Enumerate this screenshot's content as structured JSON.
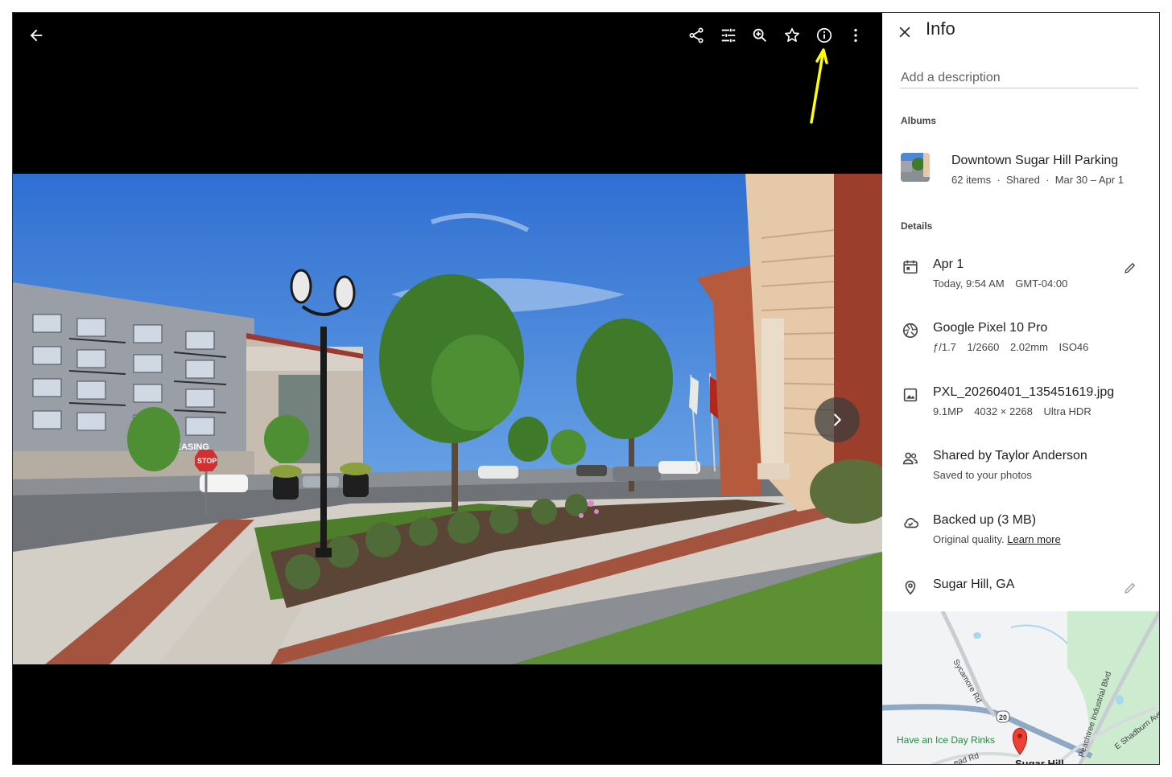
{
  "toolbar": {
    "back_icon": "arrow-back-icon",
    "share_icon": "share-icon",
    "edit_icon": "tune-icon",
    "zoom_icon": "zoom-in-icon",
    "favorite_icon": "star-icon",
    "info_icon": "info-icon",
    "more_icon": "more-vert-icon"
  },
  "viewer": {
    "next_icon": "chevron-right-icon",
    "annotation_arrow_color": "#ffff00"
  },
  "photo": {
    "sign_leasing": "LEASING",
    "sign_stop": "STOP"
  },
  "panel": {
    "title": "Info",
    "description_placeholder": "Add a description",
    "albums_label": "Albums",
    "details_label": "Details"
  },
  "album": {
    "name": "Downtown Sugar Hill Parking",
    "items": "62 items",
    "sep": "·",
    "shared": "Shared",
    "dates": "Mar 30 – Apr 1"
  },
  "details": {
    "date": {
      "main": "Apr 1",
      "time": "Today, 9:54 AM",
      "tz": "GMT-04:00"
    },
    "camera": {
      "main": "Google Pixel 10 Pro",
      "aperture": "ƒ/1.7",
      "shutter": "1/2660",
      "focal": "2.02mm",
      "iso": "ISO46"
    },
    "file": {
      "main": "PXL_20260401_135451619.jpg",
      "mp": "9.1MP",
      "dims": "4032 × 2268",
      "hdr": "Ultra HDR"
    },
    "shared": {
      "main": "Shared by Taylor Anderson",
      "sub": "Saved to your photos"
    },
    "backup": {
      "main": "Backed up (3 MB)",
      "sub": "Original quality.",
      "link": "Learn more"
    },
    "location": {
      "main": "Sugar Hill, GA"
    }
  },
  "map": {
    "road1": "Sycamore Rd",
    "road2": "Peachtree Industrial Blvd",
    "road3": "E Shadburn Ave",
    "road4": "ead Rd",
    "route": "20",
    "poi": "Have an Ice Day Rinks",
    "place": "Sugar Hill",
    "pin_color": "#ea4335",
    "poi_color": "#1e8e3e"
  }
}
